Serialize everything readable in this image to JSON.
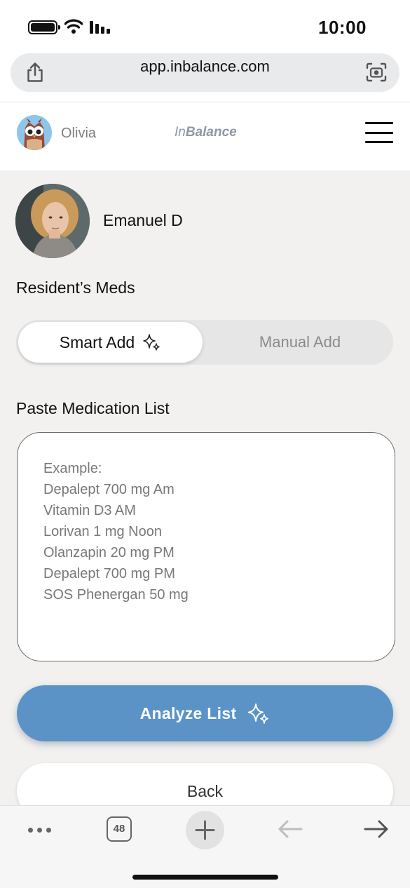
{
  "status_bar": {
    "time": "10:00"
  },
  "browser": {
    "url": "app.inbalance.com"
  },
  "header": {
    "user_name": "Olivia",
    "brand_prefix": "In",
    "brand_suffix": "Balance"
  },
  "resident": {
    "name": "Emanuel D"
  },
  "section": {
    "title": "Resident’s Meds"
  },
  "segmented": {
    "active_label": "Smart Add",
    "inactive_label": "Manual Add"
  },
  "paste": {
    "label": "Paste Medication List",
    "placeholder_lines": [
      "Example:",
      "Depalept 700 mg Am",
      "Vitamin D3 AM",
      "Lorivan 1 mg Noon",
      "Olanzapin 20 mg PM",
      "Depalept 700 mg PM",
      "SOS Phenergan 50 mg"
    ]
  },
  "buttons": {
    "analyze_label": "Analyze List",
    "back_label": "Back"
  },
  "toolbar": {
    "tab_count": "48"
  },
  "colors": {
    "accent": "#5b93c7",
    "background": "#f2f1ef"
  },
  "icons": [
    "battery-icon",
    "wifi-icon",
    "signal-icon",
    "share-icon",
    "lens-icon",
    "owl-icon",
    "menu-icon",
    "sparkle-icon",
    "more-icon",
    "tabs-icon",
    "plus-icon",
    "back-arrow-icon",
    "forward-arrow-icon"
  ]
}
